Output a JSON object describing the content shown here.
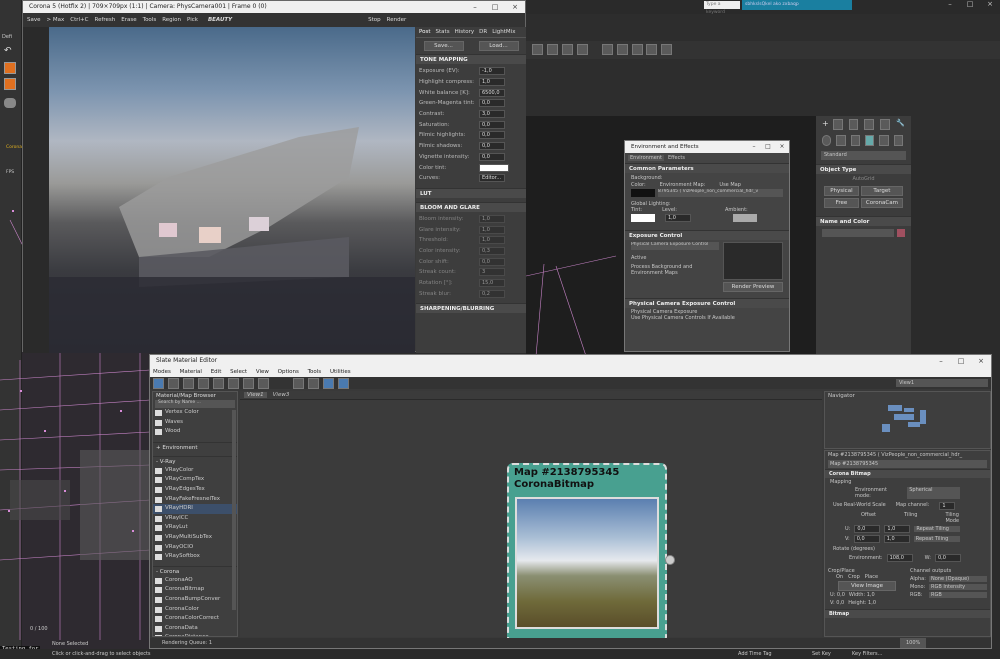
{
  "colors": {
    "accent": "#5a9aa0",
    "node_header": "#6fb3a8",
    "max_bg": "#2b2b2b",
    "wire": "#d88cd8"
  },
  "topbar": {
    "keyword_placeholder": "Type a keyword",
    "user_label": "sbhkslsQkel ako zxbaqp"
  },
  "left_toolbar": {
    "items": [
      "Defi",
      "Corona",
      "FPS"
    ],
    "testing_label": "Testing for"
  },
  "frame_buffer": {
    "title": "Corona 5 (Hotfix 2) | 709×709px (1:1) | Camera: PhysCamera001 | Frame 0 (0)",
    "toolbar": {
      "save": "Save",
      "max": "> Max",
      "copy": "Ctrl+C",
      "refresh": "Refresh",
      "erase": "Erase",
      "tools": "Tools",
      "region": "Region",
      "pick": "Pick",
      "pass": "BEAUTY",
      "stop": "Stop",
      "render": "Render"
    },
    "tabs": [
      "Post",
      "Stats",
      "History",
      "DR",
      "LightMix"
    ],
    "save_btn": "Save...",
    "load_btn": "Load...",
    "tone_mapping": {
      "title": "TONE MAPPING",
      "rows": [
        {
          "label": "Exposure (EV):",
          "value": "-1,0"
        },
        {
          "label": "Highlight compress:",
          "value": "1,0"
        },
        {
          "label": "White balance [K]:",
          "value": "6500,0"
        },
        {
          "label": "Green-Magenta tint:",
          "value": "0,0"
        },
        {
          "label": "Contrast:",
          "value": "3,0"
        },
        {
          "label": "Saturation:",
          "value": "0,0"
        },
        {
          "label": "Filmic highlights:",
          "value": "0,0"
        },
        {
          "label": "Filmic shadows:",
          "value": "0,0"
        },
        {
          "label": "Vignette intensity:",
          "value": "0,0"
        },
        {
          "label": "Color tint:",
          "value": ""
        },
        {
          "label": "Curves:",
          "value": "Editor..."
        }
      ]
    },
    "lut": {
      "title": "LUT"
    },
    "bloom": {
      "title": "BLOOM AND GLARE",
      "rows": [
        {
          "label": "Bloom intensity:",
          "value": "1,0"
        },
        {
          "label": "Glare intensity:",
          "value": "1,0"
        },
        {
          "label": "Threshold:",
          "value": "1,0"
        },
        {
          "label": "Color intensity:",
          "value": "0,3"
        },
        {
          "label": "Color shift:",
          "value": "0,0"
        },
        {
          "label": "Streak count:",
          "value": "3"
        },
        {
          "label": "Rotation [°]:",
          "value": "15,0"
        },
        {
          "label": "Streak blur:",
          "value": "0,2"
        }
      ]
    },
    "sharpening": {
      "title": "SHARPENING/BLURRING"
    }
  },
  "env_effects": {
    "title": "Environment and Effects",
    "tabs": [
      "Environment",
      "Effects"
    ],
    "common": {
      "title": "Common Parameters",
      "background": "Background:",
      "color": "Color:",
      "env_map_label": "Environment Map:",
      "use_map": "Use Map",
      "env_map_value": "8795345 ( VizPeople_non_commercial_hdr_v",
      "global_lighting": "Global Lighting:",
      "tint": "Tint:",
      "level": "Level:",
      "level_value": "1,0",
      "ambient": "Ambient:"
    },
    "exposure": {
      "title": "Exposure Control",
      "dropdown": "Physical Camera Exposure Control",
      "active": "Active",
      "process_bg": "Process Background and Environment Maps",
      "render_preview": "Render Preview"
    },
    "physical": {
      "title": "Physical Camera Exposure Control",
      "exposure_label": "Physical Camera Exposure",
      "use_controls": "Use Physical Camera Controls If Available"
    }
  },
  "create_panel": {
    "dropdown": "Standard",
    "object_type": "Object Type",
    "autogrid": "AutoGrid",
    "buttons": [
      "Physical",
      "Target",
      "Free",
      "CoronaCam"
    ],
    "name_color": "Name and Color"
  },
  "slate": {
    "title": "Slate Material Editor",
    "menu": [
      "Modes",
      "Material",
      "Edit",
      "Select",
      "View",
      "Options",
      "Tools",
      "Utilities"
    ],
    "view_dropdown": "View1",
    "browser": {
      "title": "Material/Map Browser",
      "search": "Search by Name ...",
      "items_top": [
        "Vertex Color",
        "Waves",
        "Wood"
      ],
      "environment": "+ Environment",
      "vray": "- V-Ray",
      "vray_items": [
        "VRayColor",
        "VRayCompTex",
        "VRayEdgesTex",
        "VRayFakeFresnelTex",
        "VRayHDRI",
        "VRayICC",
        "VRayLut",
        "VRayMultiSubTex",
        "VRayOCIO",
        "VRaySoftbox"
      ],
      "corona": "- Corona",
      "corona_items": [
        "CoronaAO",
        "CoronaBitmap",
        "CoronaBumpConver",
        "CoronaColor",
        "CoronaColorCorrect",
        "CoronaData",
        "CoronaDistance"
      ]
    },
    "view_tabs": [
      "View1",
      "View3"
    ],
    "node": {
      "line1": "Map #2138795345",
      "line2": "CoronaBitmap"
    },
    "navigator": "Navigator",
    "params_title": "Map #2138795345 ( VizPeople_non_commercial_hdr_",
    "params_name": "Map #2138795345",
    "corona_bitmap": "Corona Bitmap",
    "mapping": "Mapping",
    "env_mode_label": "Environment mode:",
    "env_mode_value": "Spherical",
    "real_world": "Use Real-World Scale",
    "map_channel_label": "Map channel:",
    "map_channel_value": "1",
    "offset": "Offset",
    "tiling": "Tiling",
    "tiling_mode": "Tiling Mode",
    "u": {
      "label": "U:",
      "offset": "0,0",
      "tiling": "1,0",
      "mode": "Repeat Tiling"
    },
    "v": {
      "label": "V:",
      "offset": "0,0",
      "tiling": "1,0",
      "mode": "Repeat Tiling"
    },
    "rotate": "Rotate (degrees)",
    "environment_label": "Environment:",
    "environment_value": "108,0",
    "w_label": "W:",
    "w_value": "0,0",
    "crop_place": "Crop/Place",
    "crop_on": "On",
    "crop": "Crop",
    "place": "Place",
    "view_image": "View Image",
    "crop_u": "U: 0,0",
    "crop_width": "Width: 1,0",
    "crop_v": "V: 0,0",
    "crop_height": "Height: 1,0",
    "channel_outputs": "Channel outputs",
    "alpha_label": "Alpha:",
    "alpha_value": "None (Opaque)",
    "mono_label": "Mono:",
    "mono_value": "RGB Intensity",
    "rgb_label": "RGB:",
    "rgb_value": "RGB",
    "bitmap": "Bitmap",
    "render_queue": "Rendering Queue: 1",
    "zoom": "100%"
  },
  "statusbar": {
    "none_selected": "None Selected",
    "hint": "Click or click-and-drag to select objects",
    "add_time_tag": "Add Time Tag",
    "set_key": "Set Key",
    "key_filters": "Key Filters...",
    "frame": "0 / 100"
  }
}
